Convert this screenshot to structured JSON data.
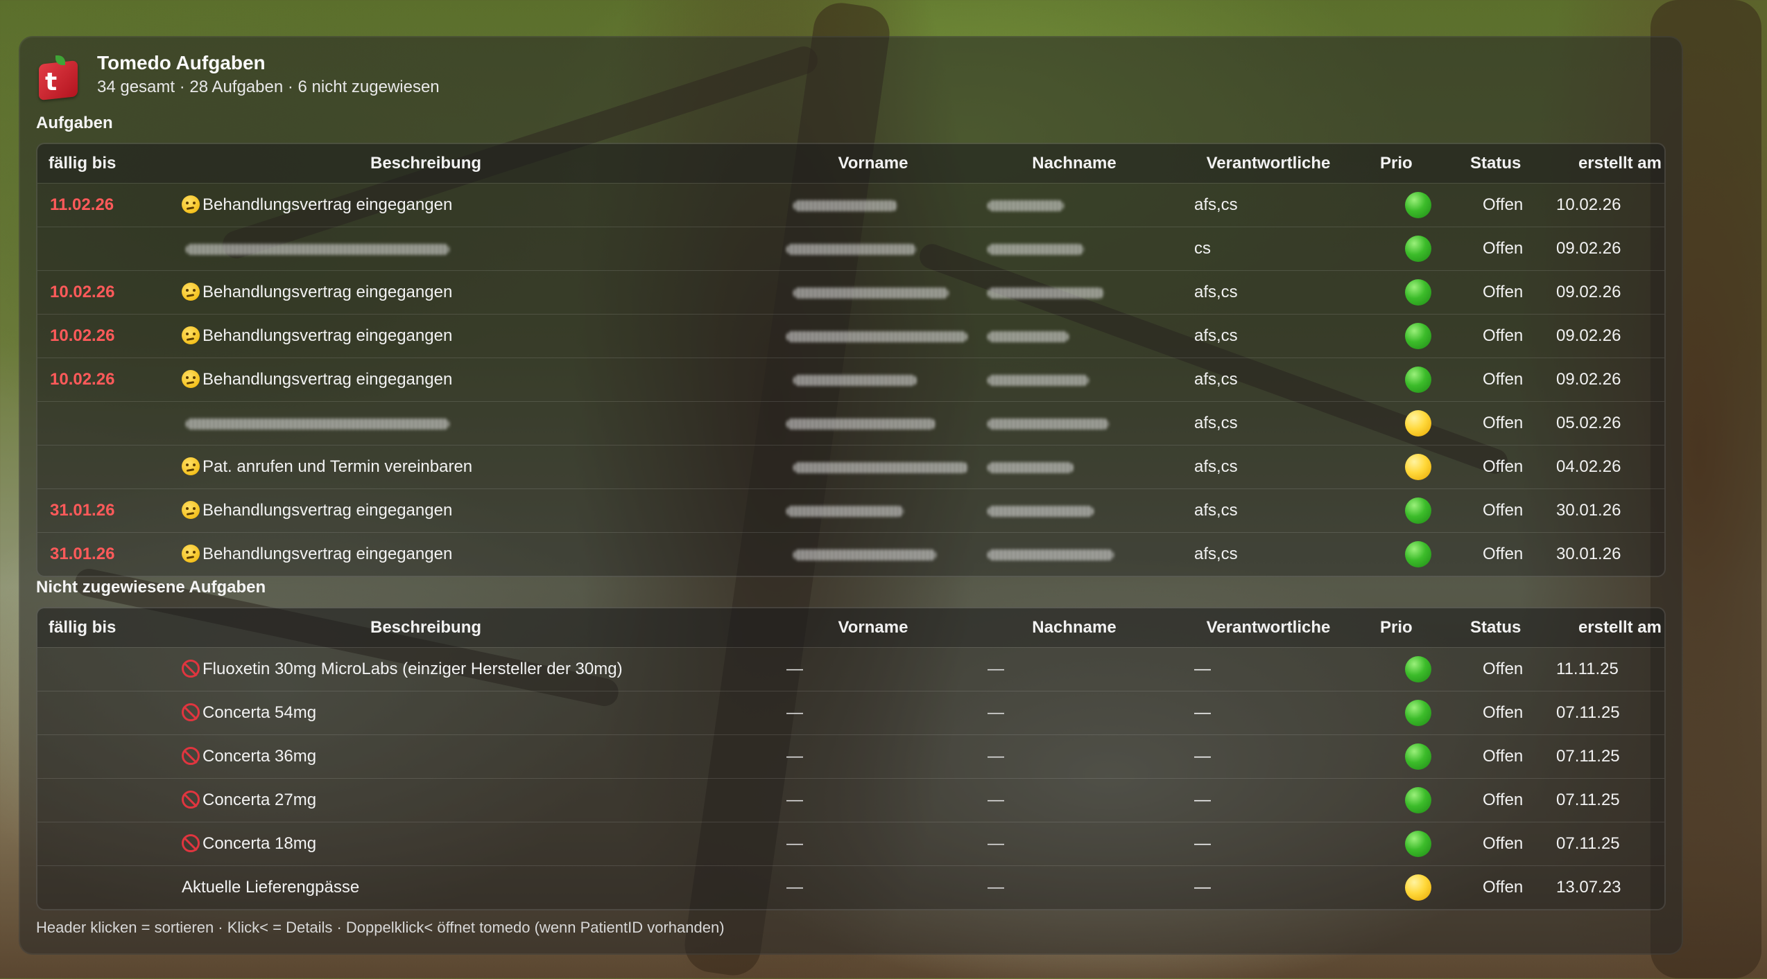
{
  "app": {
    "icon": "tomedo-app-icon",
    "icon_letter": "t",
    "title": "Tomedo Aufgaben",
    "subtitle": "34 gesamt · 28 Aufgaben · 6 nicht zugewiesen"
  },
  "columns": {
    "due": "fällig bis",
    "desc": "Beschreibung",
    "first": "Vorname",
    "last": "Nachname",
    "resp": "Verantwortliche",
    "prio": "Prio",
    "status": "Status",
    "created": "erstellt am"
  },
  "assigned": {
    "label": "Aufgaben",
    "rows": [
      {
        "due": "11.02.26",
        "icon": "face-emoji",
        "desc": "Behandlungsvertrag eingegangen",
        "resp": "afs,cs",
        "prio": "green",
        "status": "Offen",
        "created": "10.02.26"
      },
      {
        "due": "",
        "icon": "",
        "desc": "",
        "resp": "cs",
        "prio": "green",
        "status": "Offen",
        "created": "09.02.26"
      },
      {
        "due": "10.02.26",
        "icon": "face-emoji",
        "desc": "Behandlungsvertrag eingegangen",
        "resp": "afs,cs",
        "prio": "green",
        "status": "Offen",
        "created": "09.02.26"
      },
      {
        "due": "10.02.26",
        "icon": "face-emoji",
        "desc": "Behandlungsvertrag eingegangen",
        "resp": "afs,cs",
        "prio": "green",
        "status": "Offen",
        "created": "09.02.26"
      },
      {
        "due": "10.02.26",
        "icon": "face-emoji",
        "desc": "Behandlungsvertrag eingegangen",
        "resp": "afs,cs",
        "prio": "green",
        "status": "Offen",
        "created": "09.02.26"
      },
      {
        "due": "",
        "icon": "",
        "desc": "",
        "resp": "afs,cs",
        "prio": "yellow",
        "status": "Offen",
        "created": "05.02.26"
      },
      {
        "due": "",
        "icon": "face-emoji",
        "desc": "Pat. anrufen und Termin vereinbaren",
        "resp": "afs,cs",
        "prio": "yellow",
        "status": "Offen",
        "created": "04.02.26"
      },
      {
        "due": "31.01.26",
        "icon": "face-emoji",
        "desc": "Behandlungsvertrag eingegangen",
        "resp": "afs,cs",
        "prio": "green",
        "status": "Offen",
        "created": "30.01.26"
      },
      {
        "due": "31.01.26",
        "icon": "face-emoji",
        "desc": "Behandlungsvertrag eingegangen",
        "resp": "afs,cs",
        "prio": "green",
        "status": "Offen",
        "created": "30.01.26"
      }
    ]
  },
  "unassigned": {
    "label": "Nicht zugewiesene Aufgaben",
    "rows": [
      {
        "due": "",
        "icon": "forbidden-emoji",
        "desc": "Fluoxetin 30mg MicroLabs (einziger Hersteller der 30mg)",
        "first": "—",
        "last": "—",
        "resp": "—",
        "prio": "green",
        "status": "Offen",
        "created": "11.11.25"
      },
      {
        "due": "",
        "icon": "forbidden-emoji",
        "desc": "Concerta 54mg",
        "first": "—",
        "last": "—",
        "resp": "—",
        "prio": "green",
        "status": "Offen",
        "created": "07.11.25"
      },
      {
        "due": "",
        "icon": "forbidden-emoji",
        "desc": "Concerta 36mg",
        "first": "—",
        "last": "—",
        "resp": "—",
        "prio": "green",
        "status": "Offen",
        "created": "07.11.25"
      },
      {
        "due": "",
        "icon": "forbidden-emoji",
        "desc": "Concerta 27mg",
        "first": "—",
        "last": "—",
        "resp": "—",
        "prio": "green",
        "status": "Offen",
        "created": "07.11.25"
      },
      {
        "due": "",
        "icon": "forbidden-emoji",
        "desc": "Concerta 18mg",
        "first": "—",
        "last": "—",
        "resp": "—",
        "prio": "green",
        "status": "Offen",
        "created": "07.11.25"
      },
      {
        "due": "",
        "icon": "",
        "desc": "Aktuelle Lieferengpässe",
        "first": "—",
        "last": "—",
        "resp": "—",
        "prio": "yellow",
        "status": "Offen",
        "created": "13.07.23"
      }
    ]
  },
  "footer": "Header klicken = sortieren · Klick< = Details · Doppelklick< öffnet tomedo (wenn PatientID vorhanden)",
  "colors": {
    "due_red": "#ff5a5a",
    "prio_green": "#3cbc2a",
    "prio_yellow": "#ffd83a"
  }
}
